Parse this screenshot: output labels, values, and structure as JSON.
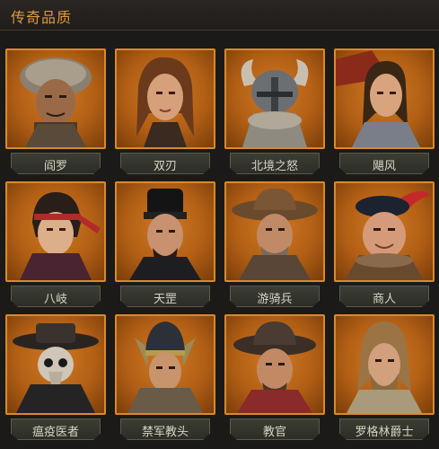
{
  "header": {
    "title": "传奇品质"
  },
  "heroes": [
    {
      "name": "阎罗",
      "icon": "fur-hat-warrior-portrait"
    },
    {
      "name": "双刃",
      "icon": "braided-woman-portrait"
    },
    {
      "name": "北境之怒",
      "icon": "horned-helmet-portrait"
    },
    {
      "name": "飓风",
      "icon": "long-haired-knight-portrait"
    },
    {
      "name": "八岐",
      "icon": "headband-samurai-portrait"
    },
    {
      "name": "天罡",
      "icon": "black-hat-official-portrait"
    },
    {
      "name": "游骑兵",
      "icon": "cowboy-hat-ranger-portrait"
    },
    {
      "name": "商人",
      "icon": "feathered-hat-merchant-portrait"
    },
    {
      "name": "瘟疫医者",
      "icon": "plague-doctor-portrait"
    },
    {
      "name": "禁军教头",
      "icon": "winged-helmet-general-portrait"
    },
    {
      "name": "教官",
      "icon": "wide-hat-instructor-portrait"
    },
    {
      "name": "罗格林爵士",
      "icon": "bearded-knight-portrait"
    }
  ],
  "colors": {
    "accent": "#e09a3a",
    "frame": "#d98a2b",
    "background": "#1b1a19"
  }
}
